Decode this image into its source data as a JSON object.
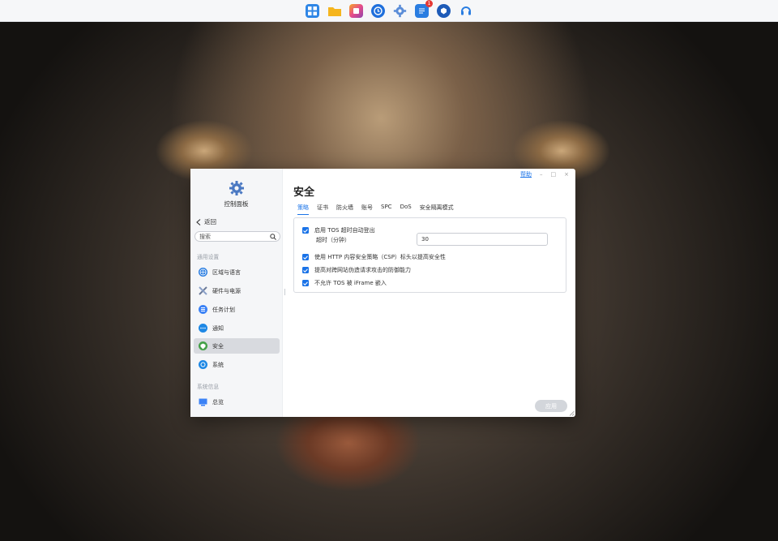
{
  "taskbar": {
    "icons": [
      {
        "name": "apps-icon",
        "color": "#2f86e6"
      },
      {
        "name": "folder-icon",
        "color": "#f5b51e"
      },
      {
        "name": "media-icon",
        "color": "#e74c8b"
      },
      {
        "name": "clock-icon",
        "color": "#1f6fdc"
      },
      {
        "name": "settings-icon",
        "color": "#5b8dd8"
      },
      {
        "name": "notes-icon",
        "color": "#2a7de1",
        "badge": "1"
      },
      {
        "name": "shield-app-icon",
        "color": "#1e5bb8"
      },
      {
        "name": "support-icon",
        "color": "#2a7de1"
      }
    ]
  },
  "sidebar": {
    "app_title": "控制面板",
    "back_label": "返回",
    "search_placeholder": "搜索",
    "section_general": "通用设置",
    "items": [
      {
        "label": "区域与语言",
        "icon": "globe-icon",
        "color": "#2a7de1"
      },
      {
        "label": "硬件与电源",
        "icon": "tools-icon",
        "color": "#6b7a99"
      },
      {
        "label": "任务计划",
        "icon": "task-list-icon",
        "color": "#3b82f6"
      },
      {
        "label": "通知",
        "icon": "chat-bubble-icon",
        "color": "#1e88e5"
      },
      {
        "label": "安全",
        "icon": "shield-icon",
        "color": "#43a047"
      },
      {
        "label": "系统",
        "icon": "system-icon",
        "color": "#1e88e5"
      }
    ],
    "section_info": "系统信息",
    "info_items": [
      {
        "label": "总览",
        "icon": "monitor-icon",
        "color": "#3b82f6"
      }
    ]
  },
  "window": {
    "help_label": "帮助",
    "minimize": "–",
    "maximize": "□",
    "close": "×"
  },
  "main": {
    "title": "安全",
    "tabs": [
      "策略",
      "证书",
      "防火墙",
      "账号",
      "SPC",
      "DoS",
      "安全隔离模式"
    ],
    "active_tab": 0,
    "options": {
      "timeout_logout": "启用 TOS 超时自动登出",
      "timeout_label": "超时（分钟）",
      "timeout_value": "30",
      "csp": "使用 HTTP 内容安全策略（CSP）标头以提高安全性",
      "csrf": "提高对跨网站伪造请求攻击的防御能力",
      "iframe": "不允许 TOS 被 iFrame 嵌入"
    },
    "apply_label": "应用"
  }
}
